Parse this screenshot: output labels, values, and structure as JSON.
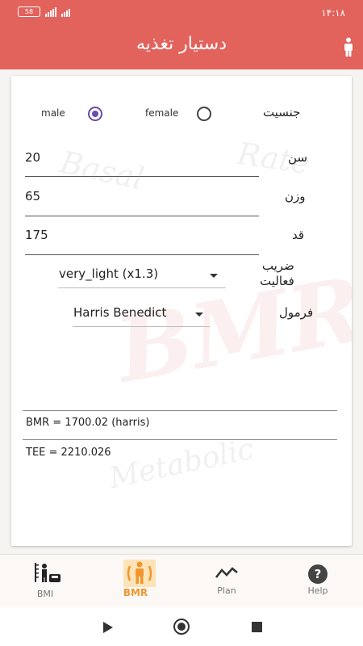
{
  "status_bar": {
    "time": "۱۴:۱۸",
    "battery": "58"
  },
  "app_bar": {
    "title": "دستیار تغذیه"
  },
  "form": {
    "gender": {
      "label": "جنسیت",
      "male_label": "male",
      "female_label": "female",
      "selected": "male"
    },
    "age": {
      "label": "سن",
      "value": "20"
    },
    "weight": {
      "label": "وزن",
      "value": "65"
    },
    "height": {
      "label": "قد",
      "value": "175"
    },
    "activity": {
      "label": "ضریب فعالیت",
      "label_line1": "ضریب",
      "label_line2": "فعالیت",
      "value": "very_light (x1.3)"
    },
    "formula": {
      "label": "فرمول",
      "value": "Harris Benedict"
    }
  },
  "results": {
    "bmr": "BMR = 1700.02  (harris)",
    "tee": "TEE = 2210.026"
  },
  "watermark": {
    "bmr": "BMR",
    "basal": "Basal",
    "rate": "Rate",
    "metabolic": "Metabolic"
  },
  "nav": [
    {
      "label": "BMI",
      "icon": "bmi-scale-icon",
      "active": false
    },
    {
      "label": "BMR",
      "icon": "bmr-person-icon",
      "active": true
    },
    {
      "label": "Plan",
      "icon": "trend-line-icon",
      "active": false
    },
    {
      "label": "Help",
      "icon": "help-circle-icon",
      "active": false
    }
  ],
  "colors": {
    "primary": "#e2625c",
    "accent": "#6a4bb0",
    "nav_active": "#f0962f"
  }
}
